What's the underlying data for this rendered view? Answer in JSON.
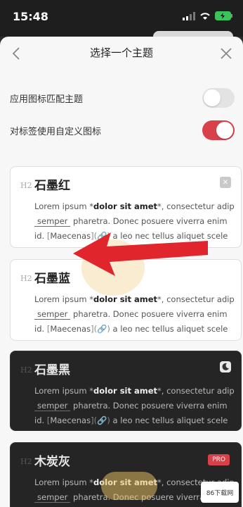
{
  "status": {
    "time": "15:48"
  },
  "nav": {
    "title": "选择一个主题"
  },
  "settings": [
    {
      "label": "应用图标匹配主题",
      "on": false
    },
    {
      "label": "对标签使用自定义图标",
      "on": true
    }
  ],
  "themes": [
    {
      "name": "石墨红",
      "h": "H2",
      "style": "light",
      "line1_pre": "Lorem ipsum *",
      "line1_bold": "dolor sit amet",
      "line1_post": "*, consectetur adip",
      "line2_link": "semper",
      "line2_post": " pharetra. Donec posuere viverra enim",
      "line3_pre": "id. ",
      "line3_link": "Maecenas",
      "line3_post": " a leo nec tellus aliquet scele"
    },
    {
      "name": "石墨蓝",
      "h": "H2",
      "style": "light-blue",
      "line1_pre": "Lorem ipsum *",
      "line1_bold": "dolor sit amet",
      "line1_post": "*, consectetur adip",
      "line2_link": "semper",
      "line2_post": " pharetra. Donec posuere viverra enim",
      "line3_pre": "id. ",
      "line3_link": "Maecenas",
      "line3_post": " a leo nec tellus aliquet scele"
    },
    {
      "name": "石墨黑",
      "h": "H2",
      "style": "dark",
      "line1_pre": "Lorem ipsum *",
      "line1_bold": "dolor sit amet",
      "line1_post": "*, consectetur adip",
      "line2_link": "semper",
      "line2_post": " pharetra. Donec posuere viverra enim",
      "line3_pre": "id. ",
      "line3_link": "Maecenas",
      "line3_post": " a leo nec tellus aliquet scele"
    },
    {
      "name": "木炭灰",
      "h": "H2",
      "style": "dark",
      "badge": "PRO",
      "line1_pre": "Lorem ipsum *",
      "line1_bold": "dolor sit amet",
      "line1_post": "*, consectetur adip",
      "line2_link": "semper",
      "line2_post": " pharetra. Donec posuere viverra enim"
    }
  ],
  "corner_badge": "86下载网",
  "colors": {
    "accent": "#d8414a",
    "blue_accent": "#3a6fc4"
  }
}
